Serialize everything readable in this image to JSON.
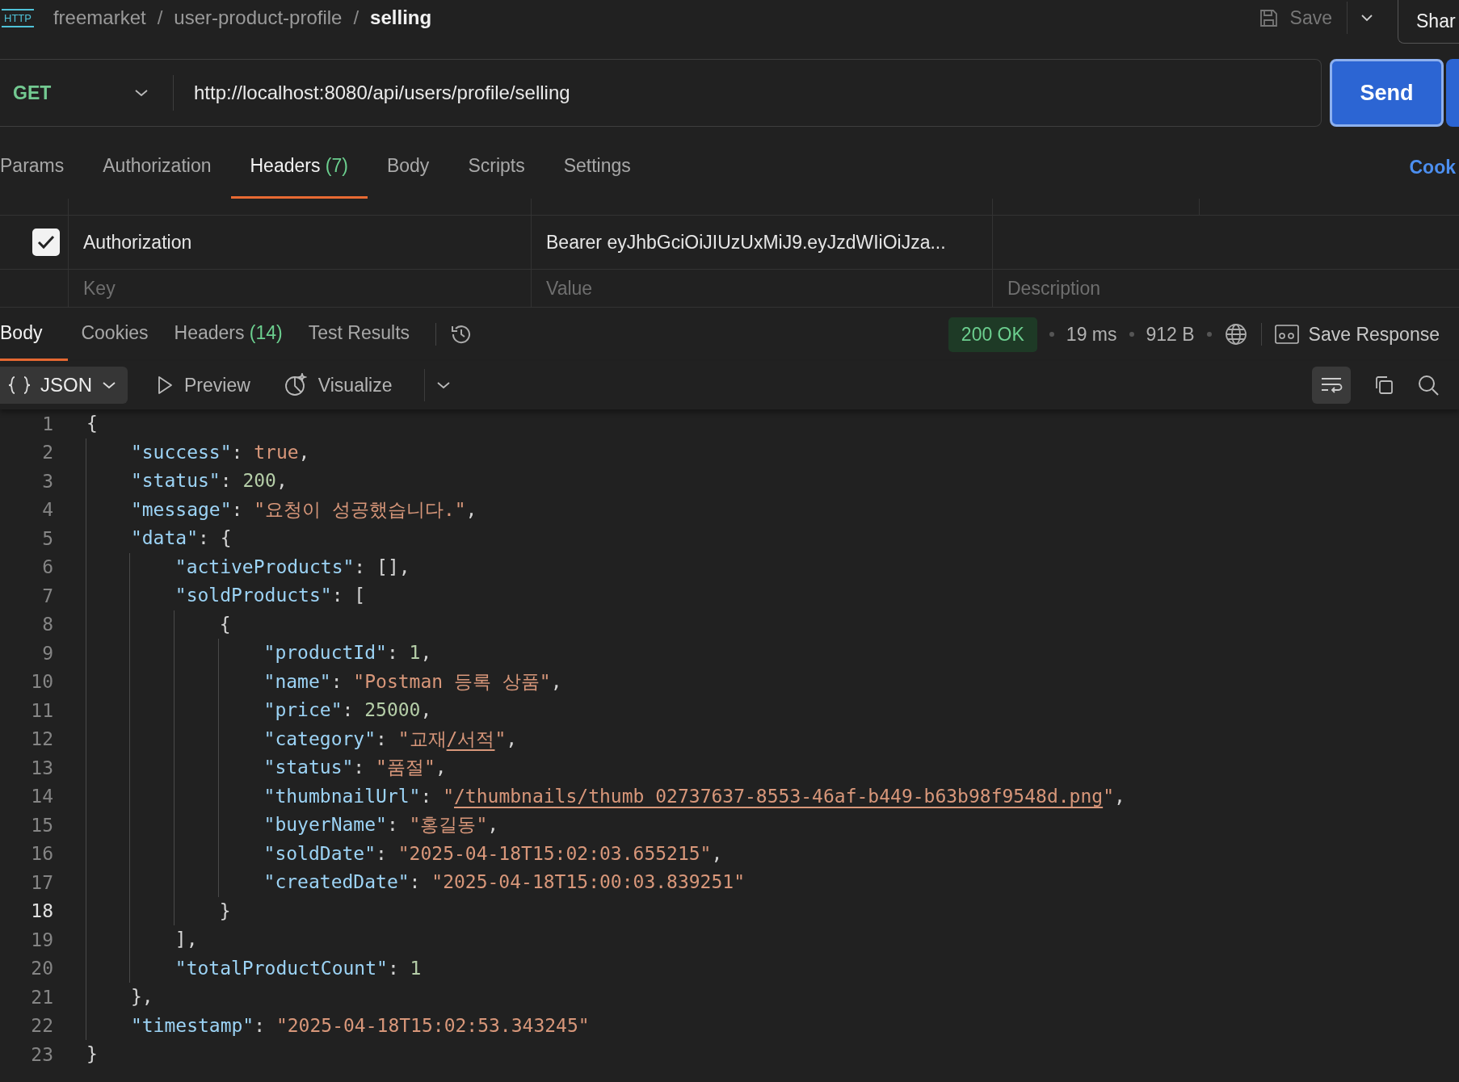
{
  "breadcrumb": {
    "icon_label": "HTTP",
    "items": [
      {
        "kind": "segment",
        "text": "freemarket",
        "current": false
      },
      {
        "kind": "separator",
        "text": "/"
      },
      {
        "kind": "segment",
        "text": "user-product-profile",
        "current": false
      },
      {
        "kind": "separator",
        "text": "/"
      },
      {
        "kind": "segment",
        "text": "selling",
        "current": true
      }
    ]
  },
  "save_button": {
    "label": "Save",
    "disabled": true
  },
  "share_button": {
    "label": "Shar"
  },
  "request": {
    "method": "GET",
    "url": "http://localhost:8080/api/users/profile/selling",
    "send_label": "Send"
  },
  "request_tabs": [
    {
      "label": "Params",
      "selected": false
    },
    {
      "label": "Authorization",
      "selected": false
    },
    {
      "label": "Headers",
      "count": "(7)",
      "selected": true
    },
    {
      "label": "Body",
      "selected": false
    },
    {
      "label": "Scripts",
      "selected": false
    },
    {
      "label": "Settings",
      "selected": false
    }
  ],
  "cookies_link": "Cook",
  "headers_table": {
    "rows": [
      {
        "enabled": true,
        "key": "Authorization",
        "value": "Bearer eyJhbGciOiJIUzUxMiJ9.eyJzdWIiOiJza..."
      }
    ],
    "placeholders": {
      "key": "Key",
      "value": "Value",
      "description": "Description"
    }
  },
  "response": {
    "tabs": [
      {
        "label": "Body",
        "selected": true
      },
      {
        "label": "Cookies",
        "selected": false
      },
      {
        "label": "Headers",
        "count": "(14)",
        "selected": false
      },
      {
        "label": "Test Results",
        "selected": false
      }
    ],
    "status": "200 OK",
    "time": "19 ms",
    "size": "912 B",
    "save_label": "Save Response",
    "format": "JSON",
    "preview_label": "Preview",
    "visualize_label": "Visualize",
    "wrap_on": true
  },
  "code_lines": [
    {
      "number": "1",
      "current": false,
      "tokens": [
        {
          "kind": "punct",
          "text": "{"
        }
      ]
    },
    {
      "number": "2",
      "current": false,
      "tokens": [
        {
          "kind": "key",
          "text": "    \"success\""
        },
        {
          "kind": "punct",
          "text": ": "
        },
        {
          "kind": "bool",
          "text": "true"
        },
        {
          "kind": "punct",
          "text": ","
        }
      ]
    },
    {
      "number": "3",
      "current": false,
      "tokens": [
        {
          "kind": "key",
          "text": "    \"status\""
        },
        {
          "kind": "punct",
          "text": ": "
        },
        {
          "kind": "num",
          "text": "200"
        },
        {
          "kind": "punct",
          "text": ","
        }
      ]
    },
    {
      "number": "4",
      "current": false,
      "tokens": [
        {
          "kind": "key",
          "text": "    \"message\""
        },
        {
          "kind": "punct",
          "text": ": "
        },
        {
          "kind": "str",
          "text": "\"요청이 성공했습니다.\""
        },
        {
          "kind": "punct",
          "text": ","
        }
      ]
    },
    {
      "number": "5",
      "current": false,
      "tokens": [
        {
          "kind": "key",
          "text": "    \"data\""
        },
        {
          "kind": "punct",
          "text": ": {"
        }
      ]
    },
    {
      "number": "6",
      "current": false,
      "tokens": [
        {
          "kind": "key",
          "text": "        \"activeProducts\""
        },
        {
          "kind": "punct",
          "text": ": [],"
        }
      ]
    },
    {
      "number": "7",
      "current": false,
      "tokens": [
        {
          "kind": "key",
          "text": "        \"soldProducts\""
        },
        {
          "kind": "punct",
          "text": ": ["
        }
      ]
    },
    {
      "number": "8",
      "current": false,
      "tokens": [
        {
          "kind": "punct",
          "text": "            {"
        }
      ]
    },
    {
      "number": "9",
      "current": false,
      "tokens": [
        {
          "kind": "key",
          "text": "                \"productId\""
        },
        {
          "kind": "punct",
          "text": ": "
        },
        {
          "kind": "num",
          "text": "1"
        },
        {
          "kind": "punct",
          "text": ","
        }
      ]
    },
    {
      "number": "10",
      "current": false,
      "tokens": [
        {
          "kind": "key",
          "text": "                \"name\""
        },
        {
          "kind": "punct",
          "text": ": "
        },
        {
          "kind": "str",
          "text": "\"Postman 등록 상품\""
        },
        {
          "kind": "punct",
          "text": ","
        }
      ]
    },
    {
      "number": "11",
      "current": false,
      "tokens": [
        {
          "kind": "key",
          "text": "                \"price\""
        },
        {
          "kind": "punct",
          "text": ": "
        },
        {
          "kind": "num",
          "text": "25000"
        },
        {
          "kind": "punct",
          "text": ","
        }
      ]
    },
    {
      "number": "12",
      "current": false,
      "tokens": [
        {
          "kind": "key",
          "text": "                \"category\""
        },
        {
          "kind": "punct",
          "text": ": "
        },
        {
          "kind": "str",
          "text": "\"교재"
        },
        {
          "kind": "link",
          "text": "/서적"
        },
        {
          "kind": "str",
          "text": "\""
        },
        {
          "kind": "punct",
          "text": ","
        }
      ]
    },
    {
      "number": "13",
      "current": false,
      "tokens": [
        {
          "kind": "key",
          "text": "                \"status\""
        },
        {
          "kind": "punct",
          "text": ": "
        },
        {
          "kind": "str",
          "text": "\"품절\""
        },
        {
          "kind": "punct",
          "text": ","
        }
      ]
    },
    {
      "number": "14",
      "current": false,
      "tokens": [
        {
          "kind": "key",
          "text": "                \"thumbnailUrl\""
        },
        {
          "kind": "punct",
          "text": ": "
        },
        {
          "kind": "str",
          "text": "\""
        },
        {
          "kind": "link",
          "text": "/thumbnails/thumb_02737637-8553-46af-b449-b63b98f9548d.png"
        },
        {
          "kind": "str",
          "text": "\""
        },
        {
          "kind": "punct",
          "text": ","
        }
      ]
    },
    {
      "number": "15",
      "current": false,
      "tokens": [
        {
          "kind": "key",
          "text": "                \"buyerName\""
        },
        {
          "kind": "punct",
          "text": ": "
        },
        {
          "kind": "str",
          "text": "\"홍길동\""
        },
        {
          "kind": "punct",
          "text": ","
        }
      ]
    },
    {
      "number": "16",
      "current": false,
      "tokens": [
        {
          "kind": "key",
          "text": "                \"soldDate\""
        },
        {
          "kind": "punct",
          "text": ": "
        },
        {
          "kind": "str",
          "text": "\"2025-04-18T15:02:03.655215\""
        },
        {
          "kind": "punct",
          "text": ","
        }
      ]
    },
    {
      "number": "17",
      "current": false,
      "tokens": [
        {
          "kind": "key",
          "text": "                \"createdDate\""
        },
        {
          "kind": "punct",
          "text": ": "
        },
        {
          "kind": "str",
          "text": "\"2025-04-18T15:00:03.839251\""
        }
      ]
    },
    {
      "number": "18",
      "current": true,
      "tokens": [
        {
          "kind": "punct",
          "text": "            }"
        }
      ]
    },
    {
      "number": "19",
      "current": false,
      "tokens": [
        {
          "kind": "punct",
          "text": "        ],"
        }
      ]
    },
    {
      "number": "20",
      "current": false,
      "tokens": [
        {
          "kind": "key",
          "text": "        \"totalProductCount\""
        },
        {
          "kind": "punct",
          "text": ": "
        },
        {
          "kind": "num",
          "text": "1"
        }
      ]
    },
    {
      "number": "21",
      "current": false,
      "tokens": [
        {
          "kind": "punct",
          "text": "    },"
        }
      ]
    },
    {
      "number": "22",
      "current": false,
      "tokens": [
        {
          "kind": "key",
          "text": "    \"timestamp\""
        },
        {
          "kind": "punct",
          "text": ": "
        },
        {
          "kind": "str",
          "text": "\"2025-04-18T15:02:53.343245\""
        }
      ]
    },
    {
      "number": "23",
      "current": false,
      "tokens": [
        {
          "kind": "punct",
          "text": "}"
        }
      ]
    }
  ]
}
